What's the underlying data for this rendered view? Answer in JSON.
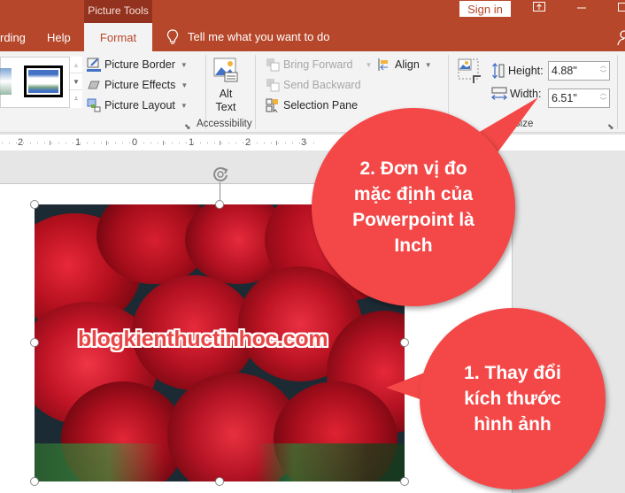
{
  "titlebar": {
    "context_tab": "Picture Tools",
    "sign_in": "Sign in",
    "window_buttons": [
      "ribbon-display-options",
      "minimize",
      "maximize"
    ]
  },
  "tabs": [
    {
      "label": "rding",
      "active": false
    },
    {
      "label": "Help",
      "active": false
    },
    {
      "label": "Format",
      "active": true
    }
  ],
  "tell_me": {
    "placeholder": "Tell me what you want to do",
    "icon": "lightbulb-icon"
  },
  "ribbon": {
    "picture_style_group": {
      "items": [
        {
          "label": "Picture Border",
          "icon": "picture-border-icon"
        },
        {
          "label": "Picture Effects",
          "icon": "picture-effects-icon"
        },
        {
          "label": "Picture Layout",
          "icon": "picture-layout-icon"
        }
      ]
    },
    "accessibility_group": {
      "alt_text_line1": "Alt",
      "alt_text_line2": "Text",
      "label": "Accessibility"
    },
    "arrange_group": {
      "items": [
        {
          "label": "Bring Forward",
          "disabled": true
        },
        {
          "label": "Send Backward",
          "disabled": true
        },
        {
          "label": "Selection Pane",
          "disabled": false
        },
        {
          "label": "Align",
          "disabled": false
        }
      ]
    },
    "size_group": {
      "height_label": "Height:",
      "height_value": "4.88\"",
      "width_label": "Width:",
      "width_value": "6.51\"",
      "label": "Size"
    }
  },
  "ruler": {
    "numbers": [
      "2",
      "1",
      "0",
      "1",
      "2",
      "3"
    ]
  },
  "slide": {
    "watermark": "blogkienthuctinhoc.com"
  },
  "callouts": [
    {
      "lines": [
        "2. Đơn vị đo",
        "mặc định của",
        "Powerpoint là",
        "Inch"
      ]
    },
    {
      "lines": [
        "1. Thay đổi",
        "kích thước",
        "hình ảnh"
      ]
    }
  ],
  "colors": {
    "accent": "#b7472a",
    "context_tab": "#93331f",
    "callout": "#f44848"
  }
}
